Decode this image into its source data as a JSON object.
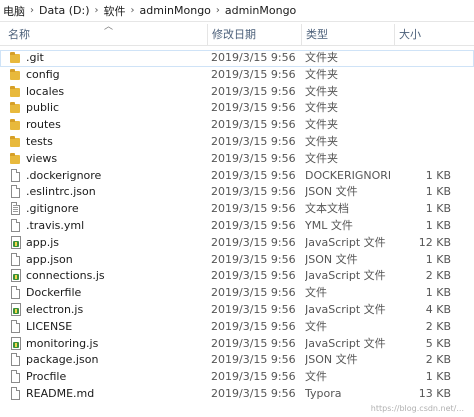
{
  "breadcrumb": {
    "items": [
      "电脑",
      "Data (D:)",
      "软件",
      "adminMongo",
      "adminMongo"
    ],
    "separator": "›"
  },
  "columns": {
    "name": "名称",
    "date": "修改日期",
    "type": "类型",
    "size": "大小"
  },
  "files": [
    {
      "name": ".git",
      "date": "2019/3/15 9:56",
      "type": "文件夹",
      "size": "",
      "icon": "folder-icon"
    },
    {
      "name": "config",
      "date": "2019/3/15 9:56",
      "type": "文件夹",
      "size": "",
      "icon": "folder-icon"
    },
    {
      "name": "locales",
      "date": "2019/3/15 9:56",
      "type": "文件夹",
      "size": "",
      "icon": "folder-icon"
    },
    {
      "name": "public",
      "date": "2019/3/15 9:56",
      "type": "文件夹",
      "size": "",
      "icon": "folder-icon"
    },
    {
      "name": "routes",
      "date": "2019/3/15 9:56",
      "type": "文件夹",
      "size": "",
      "icon": "folder-icon"
    },
    {
      "name": "tests",
      "date": "2019/3/15 9:56",
      "type": "文件夹",
      "size": "",
      "icon": "folder-icon"
    },
    {
      "name": "views",
      "date": "2019/3/15 9:56",
      "type": "文件夹",
      "size": "",
      "icon": "folder-icon"
    },
    {
      "name": ".dockerignore",
      "date": "2019/3/15 9:56",
      "type": "DOCKERIGNORE...",
      "size": "1 KB",
      "icon": "file-icon"
    },
    {
      "name": ".eslintrc.json",
      "date": "2019/3/15 9:56",
      "type": "JSON 文件",
      "size": "1 KB",
      "icon": "file-icon"
    },
    {
      "name": ".gitignore",
      "date": "2019/3/15 9:56",
      "type": "文本文档",
      "size": "1 KB",
      "icon": "text-file-icon"
    },
    {
      "name": ".travis.yml",
      "date": "2019/3/15 9:56",
      "type": "YML 文件",
      "size": "1 KB",
      "icon": "file-icon"
    },
    {
      "name": "app.js",
      "date": "2019/3/15 9:56",
      "type": "JavaScript 文件",
      "size": "12 KB",
      "icon": "js-file-icon"
    },
    {
      "name": "app.json",
      "date": "2019/3/15 9:56",
      "type": "JSON 文件",
      "size": "1 KB",
      "icon": "file-icon"
    },
    {
      "name": "connections.js",
      "date": "2019/3/15 9:56",
      "type": "JavaScript 文件",
      "size": "2 KB",
      "icon": "js-file-icon"
    },
    {
      "name": "Dockerfile",
      "date": "2019/3/15 9:56",
      "type": "文件",
      "size": "1 KB",
      "icon": "file-icon"
    },
    {
      "name": "electron.js",
      "date": "2019/3/15 9:56",
      "type": "JavaScript 文件",
      "size": "4 KB",
      "icon": "js-file-icon"
    },
    {
      "name": "LICENSE",
      "date": "2019/3/15 9:56",
      "type": "文件",
      "size": "2 KB",
      "icon": "file-icon"
    },
    {
      "name": "monitoring.js",
      "date": "2019/3/15 9:56",
      "type": "JavaScript 文件",
      "size": "5 KB",
      "icon": "js-file-icon"
    },
    {
      "name": "package.json",
      "date": "2019/3/15 9:56",
      "type": "JSON 文件",
      "size": "2 KB",
      "icon": "file-icon"
    },
    {
      "name": "Procfile",
      "date": "2019/3/15 9:56",
      "type": "文件",
      "size": "1 KB",
      "icon": "file-icon"
    },
    {
      "name": "README.md",
      "date": "2019/3/15 9:56",
      "type": "Typora",
      "size": "13 KB",
      "icon": "file-icon"
    }
  ],
  "watermark": "https://blog.csdn.net/..."
}
